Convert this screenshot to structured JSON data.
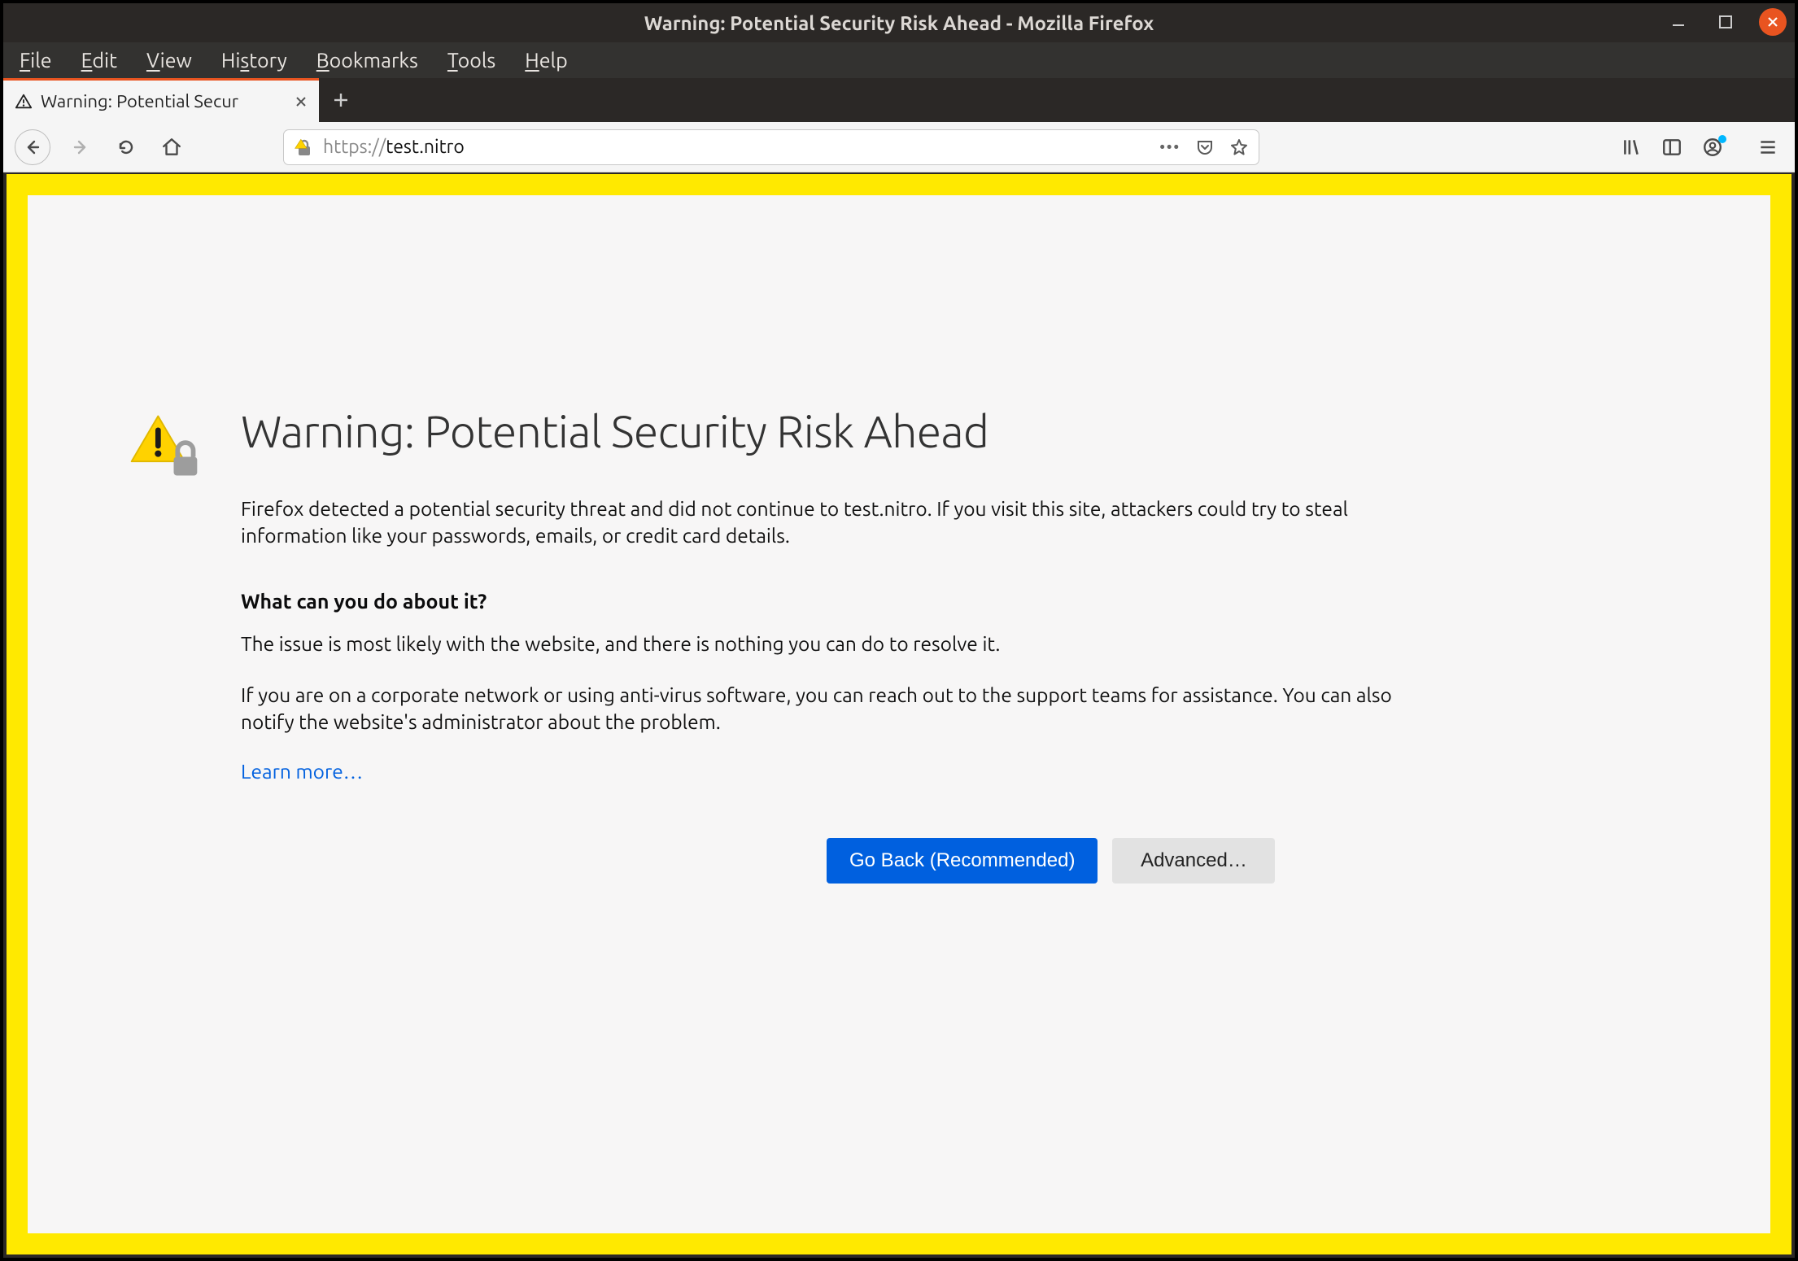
{
  "window": {
    "title": "Warning: Potential Security Risk Ahead - Mozilla Firefox"
  },
  "menubar": {
    "file": "File",
    "edit": "Edit",
    "view": "View",
    "history": "History",
    "bookmarks": "Bookmarks",
    "tools": "Tools",
    "help": "Help"
  },
  "tab": {
    "title": "Warning: Potential Secur"
  },
  "urlbar": {
    "scheme": "https://",
    "host": "test.nitro"
  },
  "page": {
    "heading": "Warning: Potential Security Risk Ahead",
    "para1": "Firefox detected a potential security threat and did not continue to test.nitro. If you visit this site, attackers could try to steal information like your passwords, emails, or credit card details.",
    "subheading": "What can you do about it?",
    "para2": "The issue is most likely with the website, and there is nothing you can do to resolve it.",
    "para3": "If you are on a corporate network or using anti-virus software, you can reach out to the support teams for assistance. You can also notify the website's administrator about the problem.",
    "learn_more": "Learn more…",
    "go_back": "Go Back (Recommended)",
    "advanced": "Advanced…"
  }
}
